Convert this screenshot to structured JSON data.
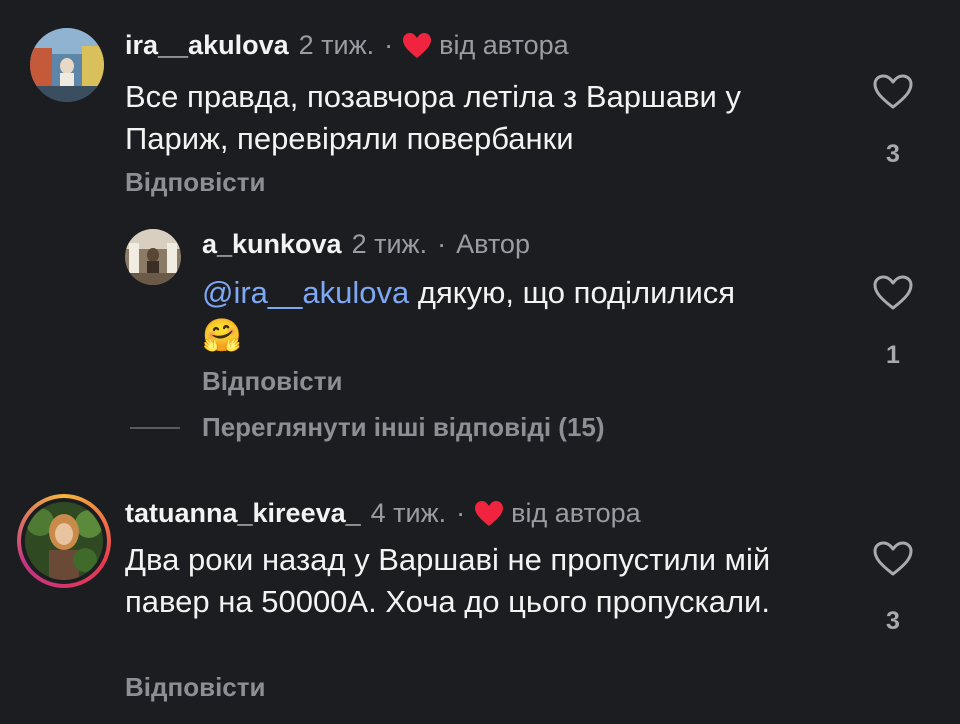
{
  "comments": [
    {
      "username": "ira__akulova",
      "time": "2 тиж.",
      "dot": "·",
      "author_badge": "від автора",
      "text": "Все правда, позавчора летіла з Варшави у Париж, перевіряли повербанки",
      "reply_label": "Відповісти",
      "likes": "3",
      "liked_by_author": true,
      "avatar_colors": [
        "#7a6a56",
        "#c9a27c",
        "#e6e1d8"
      ]
    },
    {
      "username": "a_kunkova",
      "time": "2 тиж.",
      "dot": "·",
      "author_badge": "Автор",
      "mention": "@ira__akulova",
      "text": "дякую, що поділилися",
      "emoji": "🤗",
      "reply_label": "Відповісти",
      "likes": "1",
      "avatar_colors": [
        "#6b5a48",
        "#b89c79",
        "#e0d4c2"
      ]
    },
    {
      "username": "tatuanna_kireeva_",
      "time": "4 тиж.",
      "dot": "·",
      "author_badge": "від автора",
      "text": "Два роки назад у Варшаві не пропустили мій павер на 50000А.  Хоча до цього пропускали.",
      "reply_label": "Відповісти",
      "likes": "3",
      "liked_by_author": true,
      "avatar_colors": [
        "#3f5a2a",
        "#d9a15f",
        "#7a4a2a"
      ]
    }
  ],
  "view_more_replies": "Переглянути інші відповіді (15)",
  "colors": {
    "background": "#1c1d20",
    "heart_red": "#f0243e",
    "mention_blue": "#7ea7f5",
    "muted": "#9b9ca1"
  },
  "icons": [
    "heart-icon",
    "heart-outline-icon",
    "hugging-face-emoji"
  ]
}
